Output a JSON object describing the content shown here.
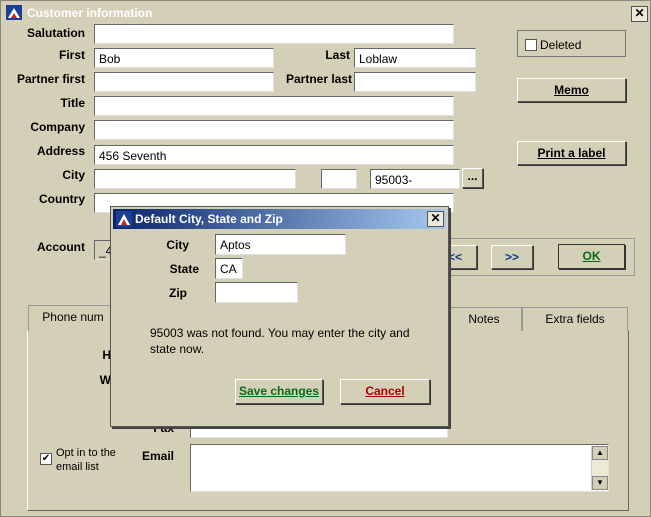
{
  "window": {
    "title": "Customer information",
    "close_glyph": "✕"
  },
  "form": {
    "salutation_label": "Salutation",
    "first_label": "First",
    "first_value": "Bob",
    "last_label": "Last",
    "last_value": "Loblaw",
    "partner_first_label": "Partner first",
    "partner_last_label": "Partner last",
    "title_label": "Title",
    "company_label": "Company",
    "address_label": "Address",
    "address_value": "456 Seventh",
    "city_label": "City",
    "zip_value": "95003-",
    "zip_lookup": "...",
    "country_label": "Country",
    "account_label": "Account",
    "account_value": "_4"
  },
  "buttons": {
    "deleted_label": "Deleted",
    "memo": "Memo",
    "print_label": "Print a label",
    "prev": "<<",
    "next": ">>",
    "ok": "OK"
  },
  "tabs": [
    {
      "label": "Phone num"
    },
    {
      "label": "Notes"
    },
    {
      "label": "Extra fields"
    }
  ],
  "contact": {
    "h_label": "H",
    "w_label": "W",
    "fax_label": "Fax",
    "email_label": "Email",
    "opt_in_label_1": "Opt in to the",
    "opt_in_label_2": "email list",
    "opt_in_checked_glyph": "✔"
  },
  "dialog": {
    "title": "Default City, State and Zip",
    "close_glyph": "✕",
    "city_label": "City",
    "city_value": "Aptos",
    "state_label": "State",
    "state_value": "CA",
    "zip_label": "Zip",
    "zip_value": "",
    "message_line1": "95003 was not found. You may enter the city and",
    "message_line2": "state now.",
    "save_button": "Save changes",
    "cancel_button": "Cancel"
  },
  "colors": {
    "background": "#d4d0b8",
    "dialog_title_start": "#0a246a",
    "dialog_title_end": "#a6caf0",
    "save_text": "#0a6a1a",
    "cancel_text": "#aa0000",
    "link_blue": "#0a3a8a"
  },
  "icons": {
    "app_icon": "app-logo-icon",
    "scroll_up": "▲",
    "scroll_down": "▼"
  }
}
